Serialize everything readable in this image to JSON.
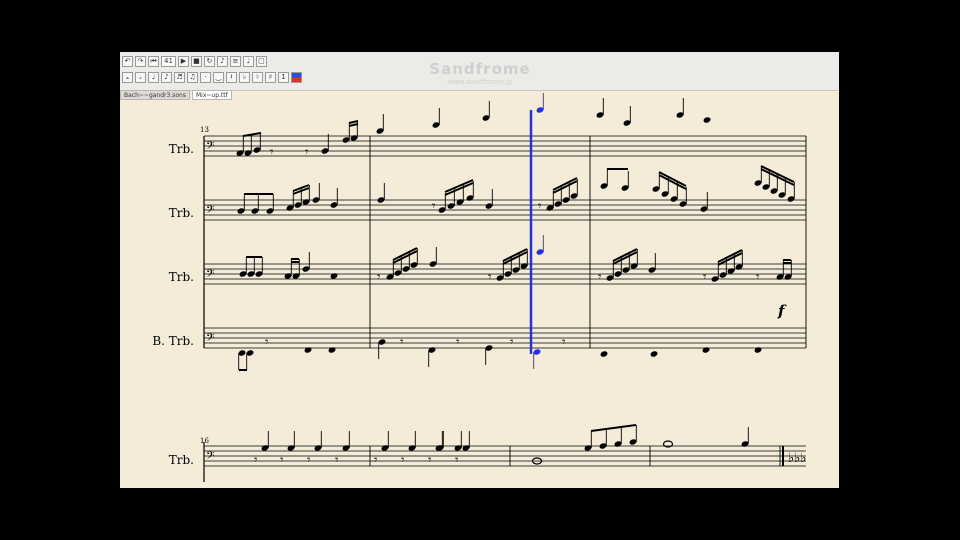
{
  "watermark": {
    "title": "Sandfrome",
    "subtitle": "www.sandfrome.jp"
  },
  "toolbar": {
    "zoom": "41"
  },
  "tabs": [
    {
      "label": "Bach~~gandr3.sons"
    },
    {
      "label": "Mix~up.ttf"
    }
  ],
  "score": {
    "system1": {
      "measure_number": "13",
      "instruments": [
        "Trb.",
        "Trb.",
        "Trb.",
        "B. Trb."
      ],
      "dynamic": "f"
    },
    "system2": {
      "measure_number": "16",
      "instruments": [
        "Trb."
      ]
    }
  },
  "colors": {
    "playhead": "#2233dd",
    "paper": "#f4ecd9",
    "highlight_note": "#2233dd"
  }
}
